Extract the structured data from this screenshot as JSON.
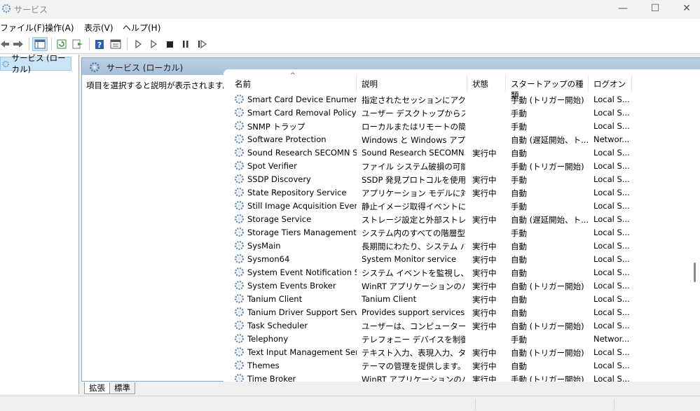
{
  "window": {
    "title": "サービス",
    "minimize": "—",
    "maximize": "☐",
    "close": "✕"
  },
  "menu": [
    {
      "label": "ファイル(F)"
    },
    {
      "label": "操作(A)"
    },
    {
      "label": "表示(V)"
    },
    {
      "label": "ヘルプ(H)"
    }
  ],
  "toolbar": {
    "buttons": [
      "back-arrow-icon",
      "forward-arrow-icon",
      "show-hide-console-tree-icon",
      "refresh-icon",
      "export-list-icon",
      "help-icon",
      "properties-icon",
      "play-icon",
      "play-alt-icon",
      "stop-icon",
      "pause-icon",
      "restart-icon"
    ]
  },
  "tree": {
    "selected_label": "サービス (ローカル)"
  },
  "content": {
    "header_title": "サービス (ローカル)",
    "description_hint": "項目を選択すると説明が表示されます。",
    "columns": [
      {
        "label": "名前"
      },
      {
        "label": "説明"
      },
      {
        "label": "状態"
      },
      {
        "label": "スタートアップの種類"
      },
      {
        "label": "ログオン"
      }
    ],
    "rows": [
      {
        "name": "Smart Card Device Enumera...",
        "desc": "指定されたセッションにアクセ...",
        "status": "",
        "startup": "手動 (トリガー開始)",
        "logon": "Local S..."
      },
      {
        "name": "Smart Card Removal Policy",
        "desc": "ユーザー デスクトップからスマー...",
        "status": "",
        "startup": "手動",
        "logon": "Local S..."
      },
      {
        "name": "SNMP トラップ",
        "desc": "ローカルまたはリモートの簡易...",
        "status": "",
        "startup": "手動",
        "logon": "Local S..."
      },
      {
        "name": "Software Protection",
        "desc": "Windows と Windows アプ...",
        "status": "",
        "startup": "自動 (遅延開始、ト...",
        "logon": "Networ..."
      },
      {
        "name": "Sound Research SECOMN S...",
        "desc": "Sound Research SECOMN...",
        "status": "実行中",
        "startup": "自動",
        "logon": "Local S..."
      },
      {
        "name": "Spot Verifier",
        "desc": "ファイル システム破損の可能...",
        "status": "",
        "startup": "手動 (トリガー開始)",
        "logon": "Local S..."
      },
      {
        "name": "SSDP Discovery",
        "desc": "SSDP 発見プロトコルを使用...",
        "status": "実行中",
        "startup": "手動",
        "logon": "Local S..."
      },
      {
        "name": "State Repository Service",
        "desc": "アプリケーション モデルに対す...",
        "status": "実行中",
        "startup": "自動",
        "logon": "Local S..."
      },
      {
        "name": "Still Image Acquisition Events",
        "desc": "静止イメージ取得イベントに...",
        "status": "",
        "startup": "手動",
        "logon": "Local S..."
      },
      {
        "name": "Storage Service",
        "desc": "ストレージ設定と外部ストレー...",
        "status": "実行中",
        "startup": "自動 (遅延開始、ト...",
        "logon": "Local S..."
      },
      {
        "name": "Storage Tiers Management",
        "desc": "システム内のすべての階層型...",
        "status": "",
        "startup": "手動",
        "logon": "Local S..."
      },
      {
        "name": "SysMain",
        "desc": "長期間にわたり、システム パ...",
        "status": "実行中",
        "startup": "自動",
        "logon": "Local S..."
      },
      {
        "name": "Sysmon64",
        "desc": "System Monitor service",
        "status": "実行中",
        "startup": "自動",
        "logon": "Local S..."
      },
      {
        "name": "System Event Notification S...",
        "desc": "システム イベントを監視し、こ...",
        "status": "実行中",
        "startup": "自動",
        "logon": "Local S..."
      },
      {
        "name": "System Events Broker",
        "desc": "WinRT アプリケーションのバッ...",
        "status": "実行中",
        "startup": "自動 (トリガー開始)",
        "logon": "Local S..."
      },
      {
        "name": "Tanium Client",
        "desc": "Tanium Client",
        "status": "実行中",
        "startup": "自動",
        "logon": "Local S..."
      },
      {
        "name": "Tanium Driver Support Servi...",
        "desc": "Provides support services ...",
        "status": "実行中",
        "startup": "自動",
        "logon": "Local S..."
      },
      {
        "name": "Task Scheduler",
        "desc": "ユーザーは、コンピューターの自...",
        "status": "実行中",
        "startup": "自動 (トリガー開始)",
        "logon": "Local S..."
      },
      {
        "name": "Telephony",
        "desc": "テレフォニー デバイスを制御す...",
        "status": "",
        "startup": "手動",
        "logon": "Networ..."
      },
      {
        "name": "Text Input Management Ser...",
        "desc": "テキスト入力、表現入力、タ...",
        "status": "実行中",
        "startup": "自動 (トリガー開始)",
        "logon": "Local S..."
      },
      {
        "name": "Themes",
        "desc": "テーマの管理を提供します。",
        "status": "実行中",
        "startup": "自動",
        "logon": "Local S..."
      },
      {
        "name": "Time Broker",
        "desc": "WinRT アプリケーションのバッ...",
        "status": "実行中",
        "startup": "手動 (トリガー開始)",
        "logon": "Local S..."
      }
    ]
  },
  "tabs": [
    {
      "label": "拡張"
    },
    {
      "label": "標準"
    }
  ],
  "colors": {
    "header_blue": "#a8c0d8",
    "selection": "#cce4f7"
  }
}
